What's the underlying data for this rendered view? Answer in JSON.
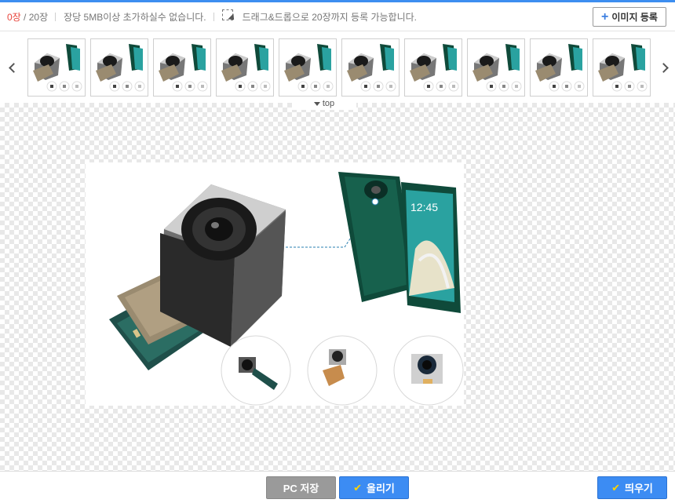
{
  "header": {
    "count_current": "0장",
    "count_total": " / 20장",
    "size_hint": "장당 5MB이상 초가하실수 없습니다.",
    "drag_hint": "드래그&드롭으로 20장까지 등록 가능합니다.",
    "register_label": "이미지 등록"
  },
  "strip": {
    "thumb_count": 10,
    "top_label": "top"
  },
  "footer": {
    "save_pc_label": "PC 저장",
    "upload_label": "올리기",
    "float_label": "띄우기"
  },
  "colors": {
    "accent": "#3d8ef0",
    "count_highlight": "#e8453c",
    "button_blue": "#3c8cf3",
    "button_gray": "#9a9a9a"
  }
}
